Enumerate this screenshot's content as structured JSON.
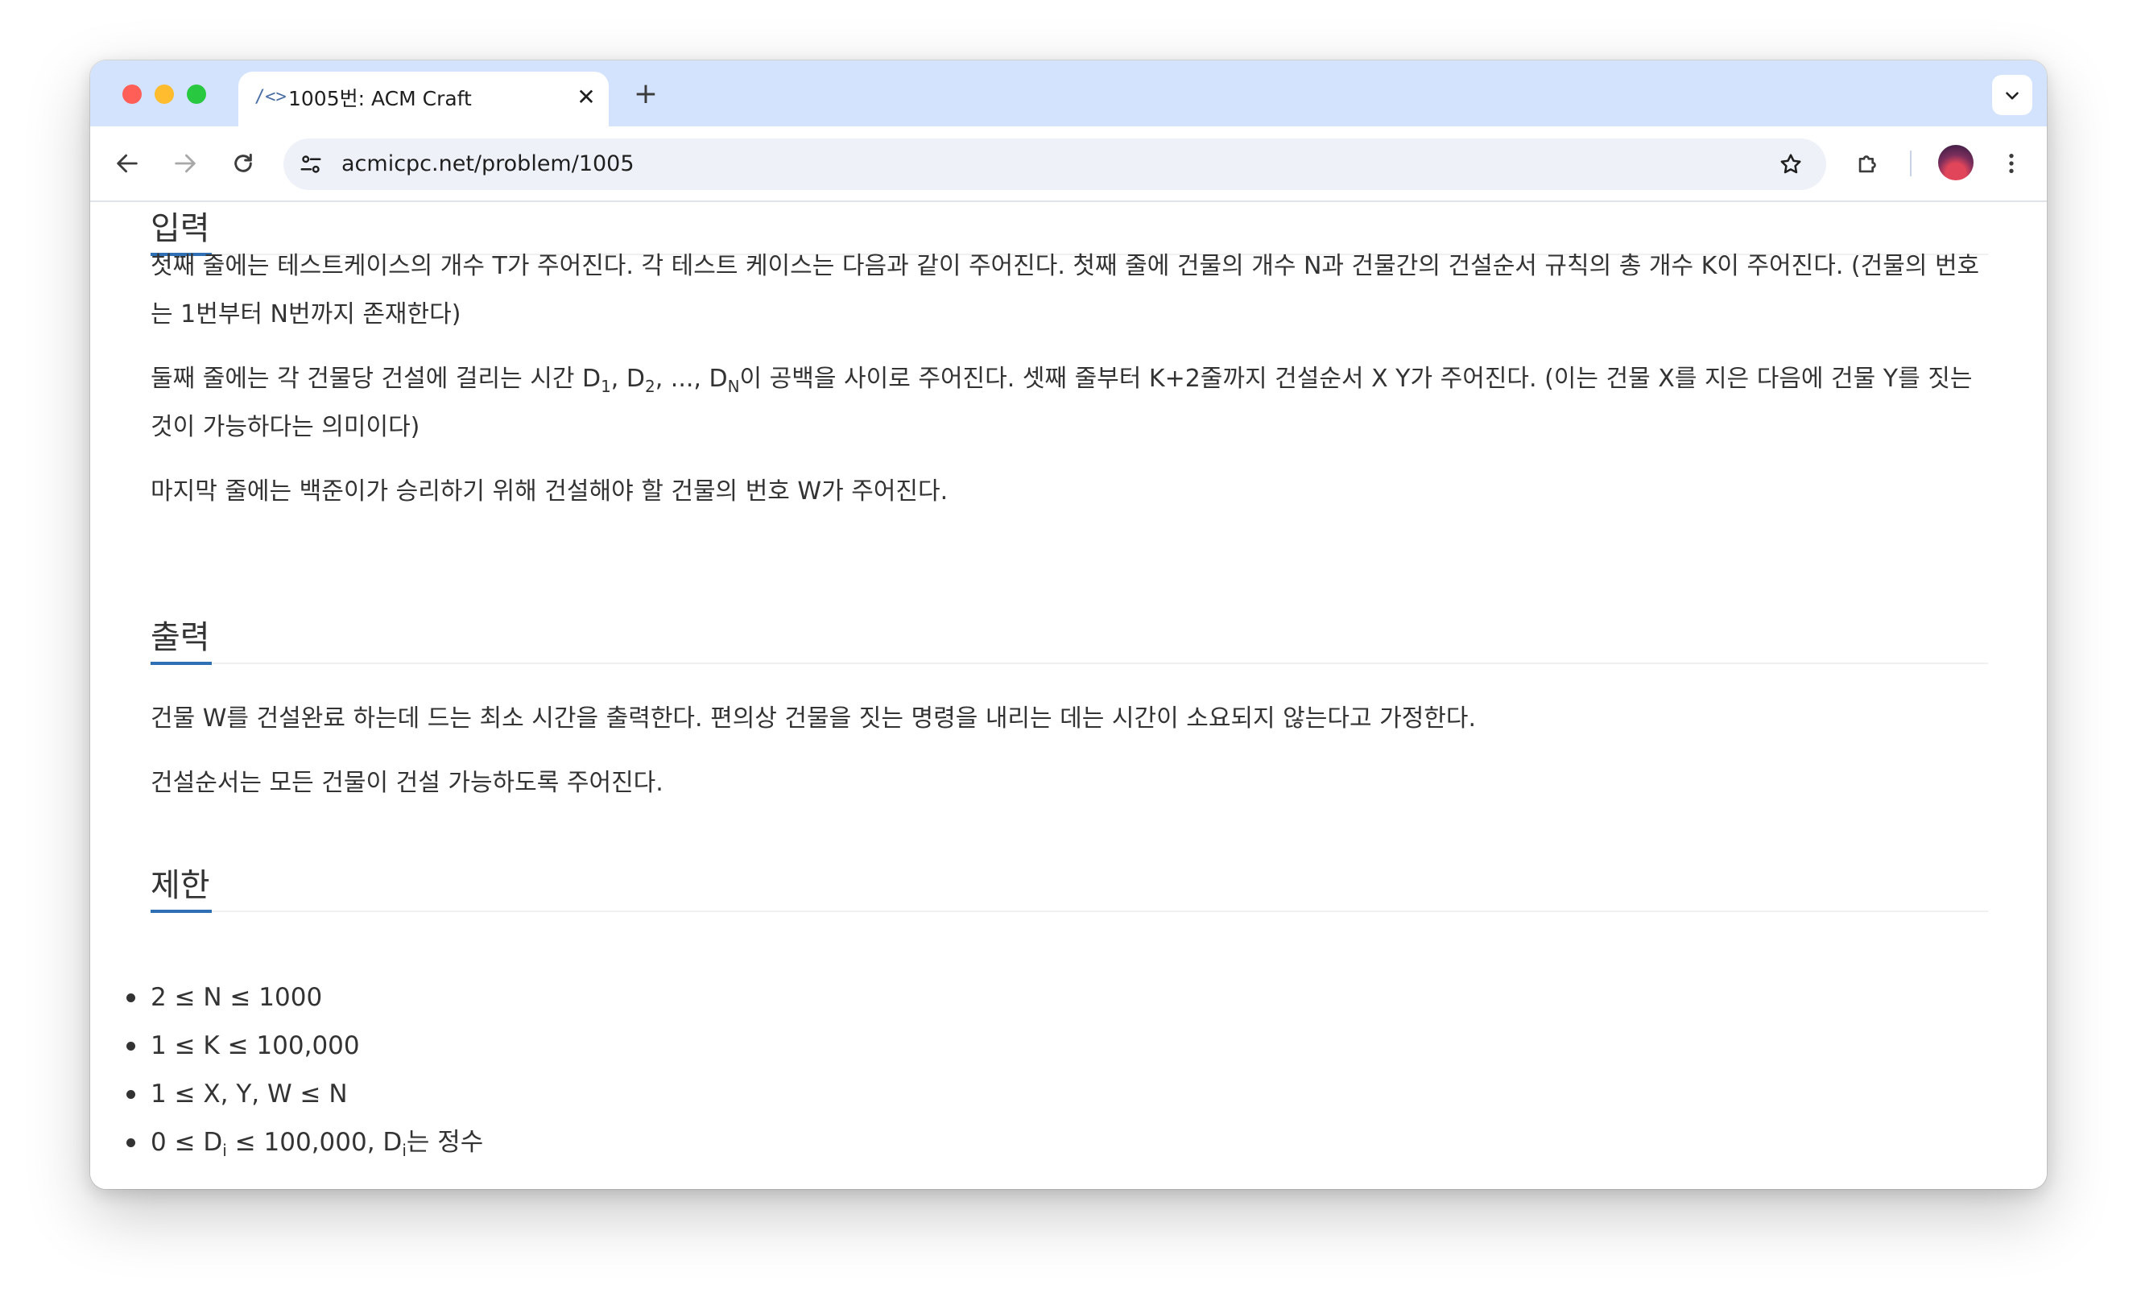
{
  "browser": {
    "tab_favicon": "/<>",
    "tab_title": "1005번: ACM Craft",
    "tab_close": "✕",
    "new_tab": "+",
    "url": "acmicpc.net/problem/1005"
  },
  "icons": {
    "tab_menu": "chevron-down-icon",
    "back": "arrow-left-icon",
    "forward": "arrow-right-icon",
    "reload": "reload-icon",
    "site_info": "tune-icon",
    "bookmark": "star-icon",
    "extensions": "puzzle-icon",
    "profile": "avatar",
    "menu": "more-vertical-icon"
  },
  "colors": {
    "tabstrip": "#d3e3fd",
    "accent": "#2f6fb3",
    "text": "#333333"
  },
  "input": {
    "title": "입력",
    "p1": "첫째 줄에는 테스트케이스의 개수 T가 주어진다. 각 테스트 케이스는 다음과 같이 주어진다. 첫째 줄에 건물의 개수 N과 건물간의 건설순서 규칙의 총 개수 K이 주어진다. (건물의 번호는 1번부터 N번까지 존재한다)",
    "p2": {
      "pre": "둘째 줄에는 각 건물당 건설에 걸리는 시간 D",
      "s1": "1",
      "mid1": ", D",
      "s2": "2",
      "mid2": ", ..., D",
      "s3": "N",
      "post": "이 공백을 사이로 주어진다. 셋째 줄부터 K+2줄까지 건설순서 X Y가 주어진다. (이는 건물 X를 지은 다음에 건물 Y를 짓는 것이 가능하다는 의미이다)"
    },
    "p3": "마지막 줄에는 백준이가 승리하기 위해 건설해야 할 건물의 번호 W가 주어진다."
  },
  "output": {
    "title": "출력",
    "p1": "건물 W를 건설완료 하는데 드는 최소 시간을 출력한다. 편의상 건물을 짓는 명령을 내리는 데는 시간이 소요되지 않는다고 가정한다.",
    "p2": "건설순서는 모든 건물이 건설 가능하도록 주어진다."
  },
  "limits": {
    "title": "제한",
    "items": [
      "2 ≤ N ≤ 1000",
      "1 ≤ K ≤ 100,000",
      "1 ≤ X, Y, W ≤ N"
    ],
    "last": {
      "pre": "0 ≤ D",
      "s1": "i",
      "mid": " ≤ 100,000, D",
      "s2": "i",
      "post": "는 정수"
    }
  }
}
